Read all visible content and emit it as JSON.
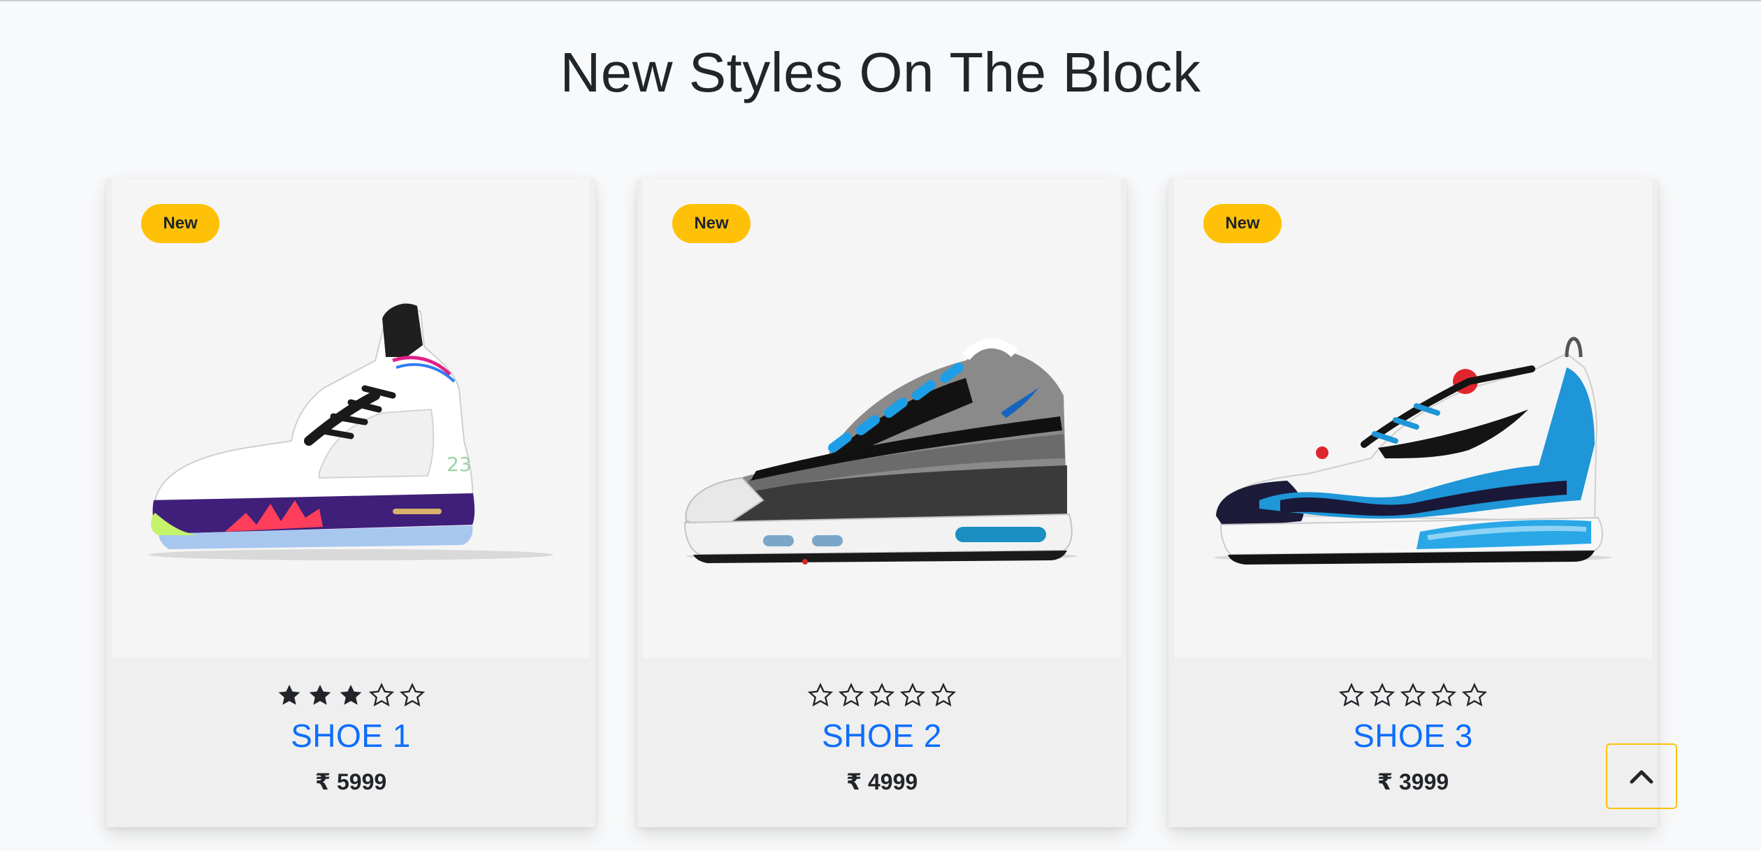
{
  "section": {
    "title": "New Styles On The Block"
  },
  "products": [
    {
      "badge": "New",
      "rating": 3,
      "max_rating": 5,
      "name": "SHOE 1",
      "price": "₹ 5999"
    },
    {
      "badge": "New",
      "rating": 0,
      "max_rating": 5,
      "name": "SHOE 2",
      "price": "₹ 4999"
    },
    {
      "badge": "New",
      "rating": 0,
      "max_rating": 5,
      "name": "SHOE 3",
      "price": "₹ 3999"
    }
  ],
  "back_to_top": {
    "icon": "chevron-up-icon"
  },
  "colors": {
    "badge": "#ffc107",
    "product_name": "#0d6efd",
    "star": "#212529"
  }
}
